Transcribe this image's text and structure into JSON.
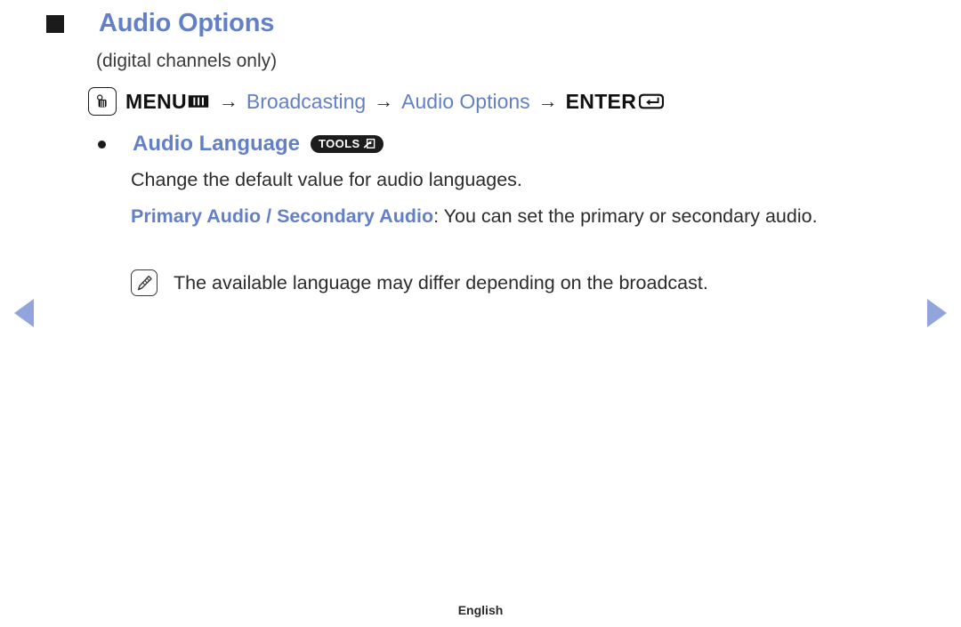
{
  "page": {
    "heading": "Audio Options",
    "subtitle": "(digital channels only)",
    "footer_language": "English",
    "accent_color": "#6380c6",
    "nav_arrow_color": "#93a4dd",
    "text_color": "#2b2b2b"
  },
  "menu_path": {
    "remote_icon": "press-button-icon",
    "menu_label": "MENU",
    "menu_glyph_icon": "menu-bars-icon",
    "separator": "→",
    "step_broadcasting": "Broadcasting",
    "step_audio_options": "Audio Options",
    "enter_label": "ENTER",
    "enter_glyph_icon": "enter-return-key-icon"
  },
  "bullet_item": {
    "bullet_icon": "round-bullet-icon",
    "title": "Audio Language",
    "badge_label": "TOOLS",
    "badge_glyph_icon": "tools-arrow-icon",
    "description": "Change the default value for audio languages.",
    "option_name": "Primary Audio / Secondary Audio",
    "option_separator": ": ",
    "option_description": "You can set the primary or secondary audio."
  },
  "note": {
    "icon": "note-pencil-icon",
    "text": "The available language may differ depending on the broadcast."
  },
  "navigation": {
    "prev_icon": "prev-page-arrow-icon",
    "next_icon": "next-page-arrow-icon"
  }
}
